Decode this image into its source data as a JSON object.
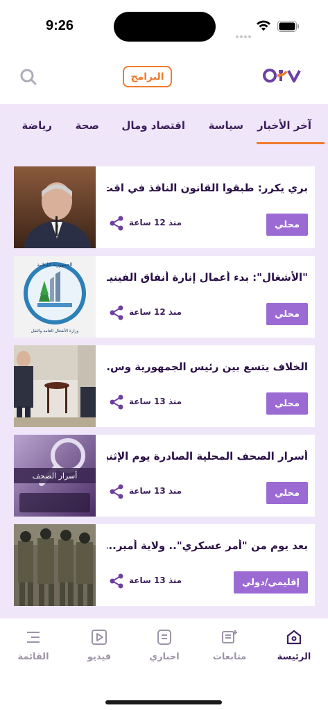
{
  "status_bar": {
    "time": "9:26"
  },
  "header": {
    "programs_label": "البرامج",
    "logo_text": "OTV",
    "accent_color": "#f07a2d",
    "brand_color": "#6d3fa3"
  },
  "tabs": [
    {
      "label": "آخر الأخبار",
      "active": true
    },
    {
      "label": "سياسة"
    },
    {
      "label": "اقتصاد ومال"
    },
    {
      "label": "صحة"
    },
    {
      "label": "رياضة"
    }
  ],
  "articles": [
    {
      "title": "بري يكرر: طبقوا القانون النافذ في اقت...",
      "category": "محلي",
      "time": "منذ 12 ساعة",
      "thumb": "speaker-photo"
    },
    {
      "title": "\"الأشغال\": بدء أعمال إنارة أنفاق الفينيـ...",
      "category": "محلي",
      "time": "منذ 12 ساعة",
      "thumb": "ministry-seal",
      "thumb_text_top": "الجمهورية اللبنانية",
      "thumb_text_bottom": "وزارة الأشغال العامة والنقل"
    },
    {
      "title": "الخلاف يتسع بين رئيس الجمهورية وس...",
      "category": "محلي",
      "time": "منذ 13 ساعة",
      "thumb": "meeting-photo"
    },
    {
      "title": "أسرار الصحف المحلية الصادرة يوم الإثنيـ...",
      "category": "محلي",
      "time": "منذ 13 ساعة",
      "thumb": "newspaper-graphic",
      "thumb_caption": "أسرار الصحف"
    },
    {
      "title": "بعد يوم من \"أمر عسكري\".. ولاية أمير...",
      "category": "إقليمي/دولي",
      "time": "منذ 13 ساعة",
      "thumb": "soldiers-photo"
    }
  ],
  "bottom_nav": [
    {
      "label": "الرئيسة",
      "icon": "home-icon",
      "active": true
    },
    {
      "label": "متابعات",
      "icon": "follow-icon"
    },
    {
      "label": "اخباري",
      "icon": "news-icon"
    },
    {
      "label": "فيديو",
      "icon": "video-icon"
    },
    {
      "label": "القائمة",
      "icon": "menu-icon"
    }
  ]
}
